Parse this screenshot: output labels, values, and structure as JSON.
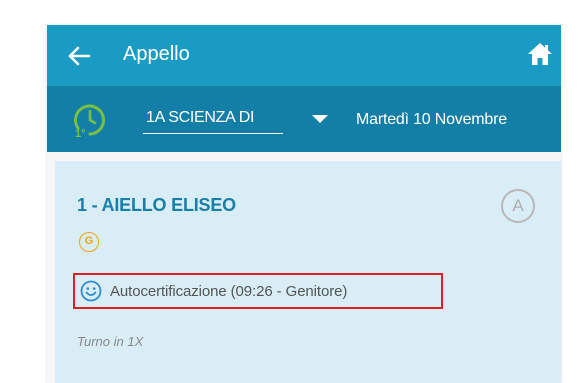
{
  "header": {
    "title": "Appello",
    "back_icon": "arrow-left-icon",
    "home_icon": "home-icon"
  },
  "toolbar": {
    "class_icon": "clock-hour-icon",
    "class_icon_text": "1°",
    "class_select_value": "1A SCIENZA DI",
    "dropdown_icon": "caret-down-icon",
    "date": "Martedì 10 Novembre"
  },
  "student": {
    "name": "1 - AIELLO ELISEO",
    "absent_badge": "A",
    "guardian_badge": "G",
    "self_cert_icon": "smiley-icon",
    "self_certification": "Autocertificazione (09:26 - Genitore)",
    "turn_note": "Turno in 1X"
  },
  "colors": {
    "appbar": "#1a9bc4",
    "toolbar": "#147fa6",
    "card": "#d8edf5",
    "student_name": "#1a7fa8",
    "clock_icon": "#78c043",
    "guardian_badge": "#f2a216",
    "highlight_border": "#e21f26"
  }
}
